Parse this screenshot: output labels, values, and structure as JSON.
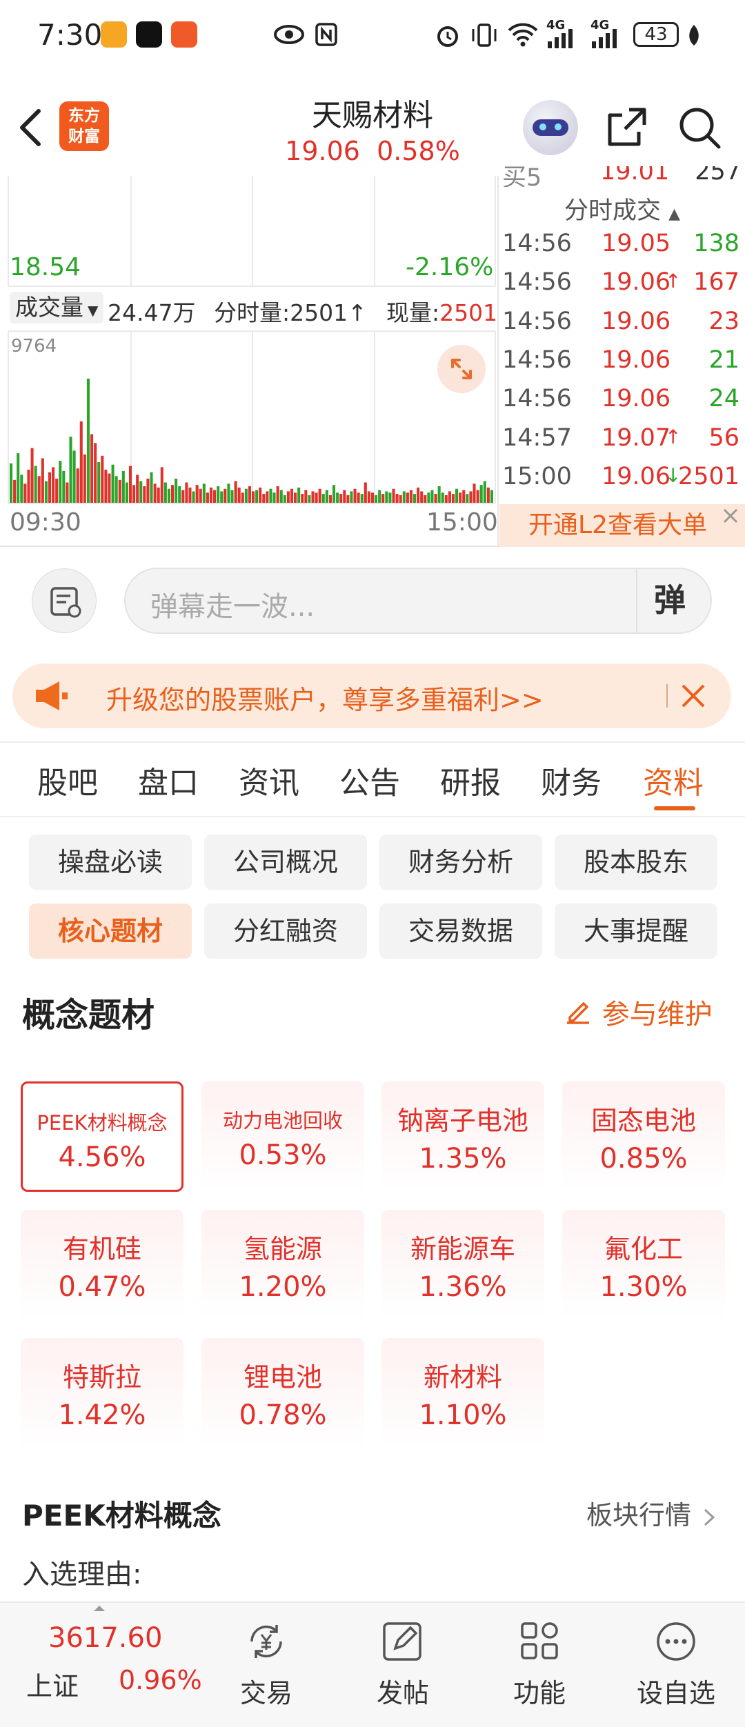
{
  "status_bar": {
    "time": "7:30",
    "network_1": "4G",
    "network_2": "4G",
    "battery": "43"
  },
  "header": {
    "logo_line1": "东方",
    "logo_line2": "财富",
    "title": "天赐材料",
    "price": "19.06",
    "change": "0.58%"
  },
  "chart": {
    "low_price": "18.54",
    "low_pct": "-2.16%",
    "volume_selector": "成交量",
    "volume_total": "24.47万",
    "volume_time_label": "分时量:2501",
    "now_label": "现量:",
    "now_value": "2501",
    "max_volume": "9764",
    "time_start": "09:30",
    "time_end": "15:00"
  },
  "chart_data": {
    "type": "bar",
    "title": "",
    "xlabel": "",
    "ylabel": "",
    "x_range": [
      "09:30",
      "15:00"
    ],
    "ylim": [
      0,
      9764
    ],
    "series": [
      {
        "values": [
          3100,
          1800,
          3900,
          2200,
          1500,
          2600,
          4300,
          2900,
          2100,
          3500,
          1700,
          2400,
          2800,
          1900,
          3300,
          2500,
          1600,
          5200,
          4100,
          2700,
          6400,
          3800,
          9764,
          5400,
          4700,
          3200,
          3700,
          2600,
          2300,
          3000,
          2100,
          1800,
          2500,
          1600,
          2900,
          1400,
          2200,
          1700,
          1300,
          1900,
          2400,
          1500,
          1200,
          2800,
          1600,
          1100,
          1400,
          1900,
          1300,
          1000,
          1600,
          1200,
          900,
          1400,
          1100,
          1500,
          800,
          1200,
          1000,
          1300,
          900,
          1100,
          1500,
          1000,
          1700,
          1200,
          800,
          1100,
          1300,
          900,
          1000,
          1200,
          700,
          900,
          1100,
          800,
          1300,
          1000,
          600,
          900,
          1100,
          800,
          1200,
          700,
          1000,
          600,
          900,
          800,
          1100,
          700,
          1000,
          600,
          1400,
          800,
          700,
          1000,
          600,
          900,
          1100,
          800,
          700,
          1600,
          900,
          800,
          600,
          1000,
          700,
          900,
          800,
          1100,
          700,
          600,
          900,
          800,
          1000,
          700,
          1200,
          900,
          600,
          800,
          1000,
          700,
          1300,
          800,
          600,
          900,
          700,
          1100,
          800,
          1000,
          700,
          900,
          1500,
          1000,
          1400,
          1700,
          1200,
          1000
        ]
      }
    ]
  },
  "ticks": {
    "header": "分时成交",
    "partial_row": {
      "label": "买5",
      "price": "19.01",
      "vol": "257"
    },
    "rows": [
      {
        "time": "14:56",
        "price": "19.05",
        "dir": "",
        "vol": "138",
        "vol_color": "#2aa52a"
      },
      {
        "time": "14:56",
        "price": "19.06",
        "dir": "↑",
        "vol": "167",
        "vol_color": "#e0312a"
      },
      {
        "time": "14:56",
        "price": "19.06",
        "dir": "",
        "vol": "23",
        "vol_color": "#e0312a"
      },
      {
        "time": "14:56",
        "price": "19.06",
        "dir": "",
        "vol": "21",
        "vol_color": "#2aa52a"
      },
      {
        "time": "14:56",
        "price": "19.06",
        "dir": "",
        "vol": "24",
        "vol_color": "#2aa52a"
      },
      {
        "time": "14:57",
        "price": "19.07",
        "dir": "↑",
        "vol": "56",
        "vol_color": "#e0312a"
      },
      {
        "time": "15:00",
        "price": "19.06",
        "dir": "↓",
        "vol": "2501",
        "vol_color": "#e0312a"
      }
    ],
    "l2_banner": "开通L2查看大单"
  },
  "barrage": {
    "placeholder": "弹幕走一波...",
    "send_label": "弹"
  },
  "promo": {
    "text": "升级您的股票账户，尊享多重福利>>"
  },
  "tabs": [
    {
      "label": "股吧"
    },
    {
      "label": "盘口"
    },
    {
      "label": "资讯"
    },
    {
      "label": "公告"
    },
    {
      "label": "研报"
    },
    {
      "label": "财务"
    },
    {
      "label": "资料"
    }
  ],
  "active_tab": "资料",
  "sub_tabs": [
    {
      "label": "操盘必读"
    },
    {
      "label": "公司概况"
    },
    {
      "label": "财务分析"
    },
    {
      "label": "股本股东"
    },
    {
      "label": "核心题材"
    },
    {
      "label": "分红融资"
    },
    {
      "label": "交易数据"
    },
    {
      "label": "大事提醒"
    }
  ],
  "concepts_section": {
    "title": "概念题材",
    "maintain_label": "参与维护",
    "items": [
      {
        "name": "PEEK材料概念",
        "pct": "4.56%"
      },
      {
        "name": "动力电池回收",
        "pct": "0.53%"
      },
      {
        "name": "钠离子电池",
        "pct": "1.35%"
      },
      {
        "name": "固态电池",
        "pct": "0.85%"
      },
      {
        "name": "有机硅",
        "pct": "0.47%"
      },
      {
        "name": "氢能源",
        "pct": "1.20%"
      },
      {
        "name": "新能源车",
        "pct": "1.36%"
      },
      {
        "name": "氟化工",
        "pct": "1.30%"
      },
      {
        "name": "特斯拉",
        "pct": "1.42%"
      },
      {
        "name": "锂电池",
        "pct": "0.78%"
      },
      {
        "name": "新材料",
        "pct": "1.10%"
      }
    ]
  },
  "detail": {
    "title": "PEEK材料概念",
    "link_label": "板块行情",
    "reason_label": "入选理由:"
  },
  "bottom_nav": {
    "index_value": "3617.60",
    "index_name": "上证",
    "index_pct": "0.96%",
    "items": [
      {
        "label": "交易"
      },
      {
        "label": "发帖"
      },
      {
        "label": "功能"
      },
      {
        "label": "设自选"
      }
    ]
  },
  "colors": {
    "up": "#e0312a",
    "down": "#2aa52a",
    "accent": "#f06a1d"
  }
}
